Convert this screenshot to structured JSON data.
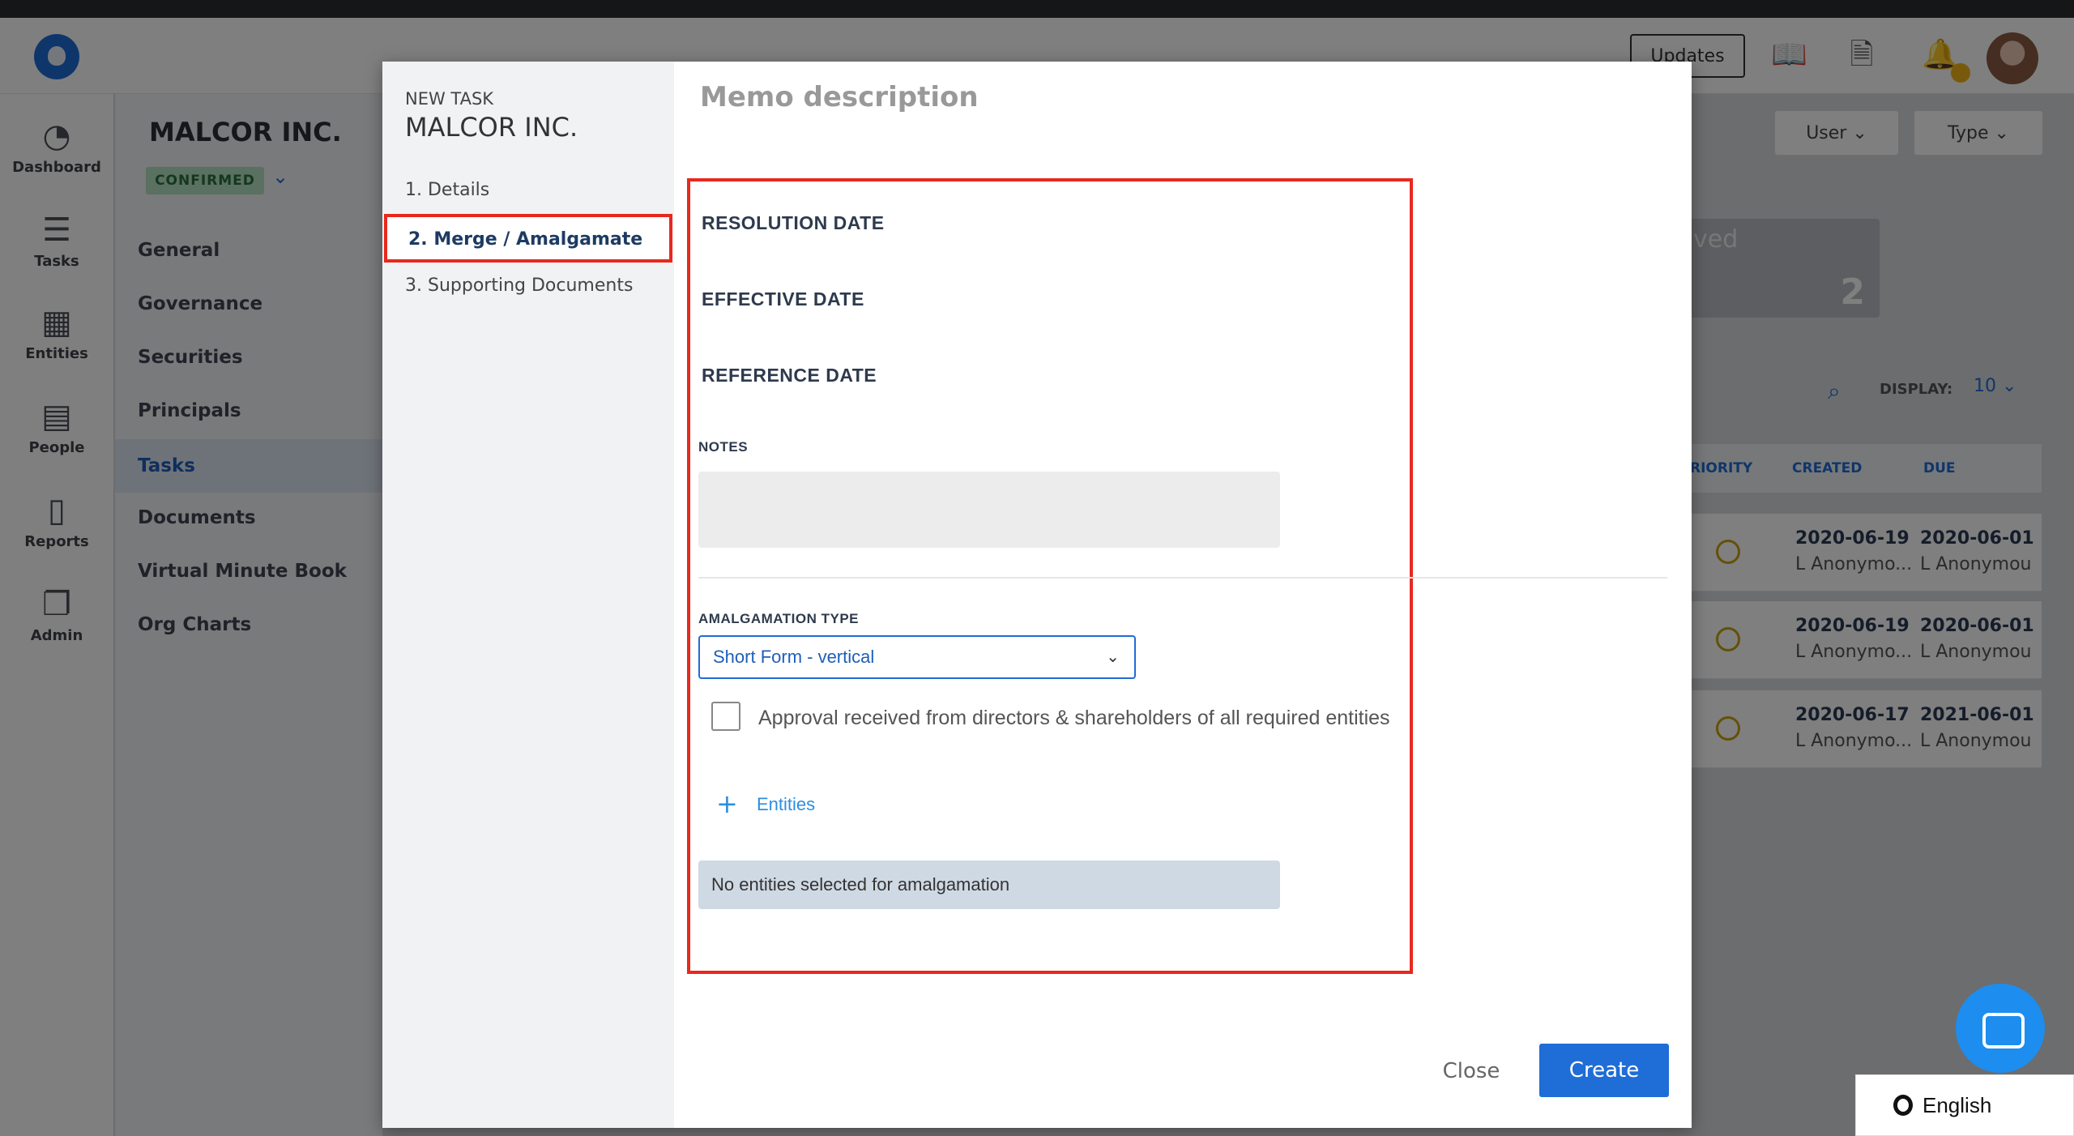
{
  "header": {
    "updates_label": "Updates"
  },
  "left_nav": [
    {
      "label": "Dashboard",
      "icon": "gauge-icon"
    },
    {
      "label": "Tasks",
      "icon": "checklist-icon"
    },
    {
      "label": "Entities",
      "icon": "building-icon"
    },
    {
      "label": "People",
      "icon": "id-card-icon"
    },
    {
      "label": "Reports",
      "icon": "document-icon"
    },
    {
      "label": "Admin",
      "icon": "copy-icon"
    }
  ],
  "entity_panel": {
    "title": "MALCOR INC.",
    "status": "CONFIRMED",
    "links": [
      "General",
      "Governance",
      "Securities",
      "Principals",
      "Tasks",
      "Documents",
      "Virtual Minute Book",
      "Org Charts"
    ],
    "active_link": "Tasks"
  },
  "background": {
    "filters": {
      "user": "User",
      "type": "Type"
    },
    "stat_card": {
      "label": "ved",
      "value": "2"
    },
    "display_label": "DISPLAY:",
    "display_value": "10",
    "table_headers": {
      "priority": "RIORITY",
      "created": "CREATED",
      "due": "DUE"
    },
    "rows": [
      {
        "created": "2020-06-19",
        "due": "2020-06-01",
        "user1": "L Anonymo...",
        "user2": "L Anonymou"
      },
      {
        "created": "2020-06-19",
        "due": "2020-06-01",
        "user1": "L Anonymo...",
        "user2": "L Anonymou"
      },
      {
        "created": "2020-06-17",
        "due": "2021-06-01",
        "user1": "L Anonymo...",
        "user2": "L Anonymou"
      }
    ]
  },
  "modal": {
    "kicker": "NEW TASK",
    "entity": "MALCOR INC.",
    "steps": [
      "1. Details",
      "2. Merge / Amalgamate",
      "3. Supporting Documents"
    ],
    "memo_title": "Memo description",
    "fields": {
      "resolution_date": "RESOLUTION DATE",
      "effective_date": "EFFECTIVE DATE",
      "reference_date": "REFERENCE DATE",
      "notes": "NOTES",
      "amalgamation_type": "AMALGAMATION TYPE"
    },
    "amalgamation_value": "Short Form - vertical",
    "approval_label": "Approval received from directors & shareholders of all required entities",
    "entities_link": "Entities",
    "entities_empty": "No entities selected for amalgamation",
    "close_label": "Close",
    "create_label": "Create"
  },
  "footer": {
    "language": "English"
  },
  "colors": {
    "primary": "#1f6dd6",
    "highlight": "#e8281e",
    "confirmed_bg": "#b5e0c1"
  }
}
